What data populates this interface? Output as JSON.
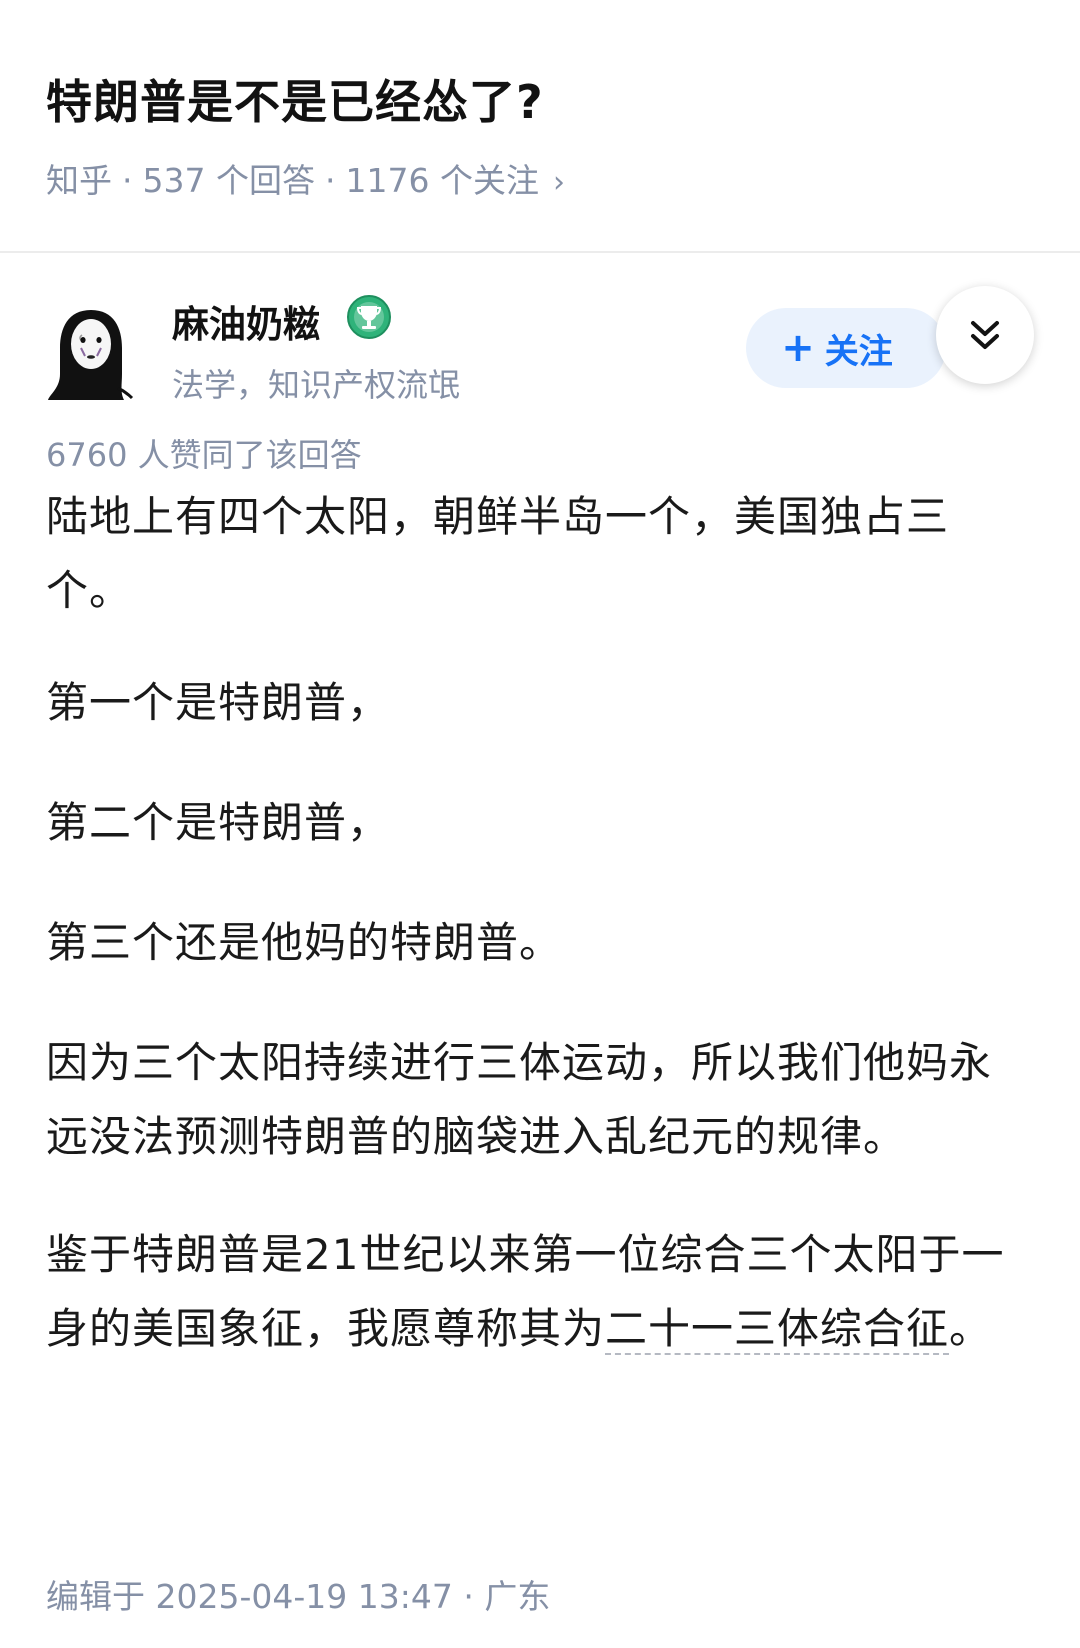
{
  "question": {
    "title": "特朗普是不是已经怂了?",
    "source": "知乎",
    "answers_count": "537 个回答",
    "followers_count": "1176 个关注",
    "separator": "·",
    "chevron": "›"
  },
  "author": {
    "name": "麻油奶糍",
    "bio": "法学，知识产权流氓",
    "badge_icon": "trophy-badge-icon",
    "follow_plus": "+",
    "follow_label": "关注",
    "collapse_icon": "double-chevron-down-icon"
  },
  "answer": {
    "votes": "6760 人赞同了该回答",
    "paragraphs": [
      "陆地上有四个太阳，朝鲜半岛一个，美国独占三个。",
      "第一个是特朗普，",
      "第二个是特朗普，",
      "第三个还是他妈的特朗普。",
      "因为三个太阳持续进行三体运动，所以我们他妈永远没法预测特朗普的脑袋进入乱纪元的规律。"
    ],
    "last_paragraph_before": "鉴于特朗普是21世纪以来第一位综合三个太阳于一身的美国象征，我愿尊称其为",
    "last_paragraph_term": "二十一三体综合征",
    "last_paragraph_after": "。",
    "edited": "编辑于 2025-04-19 13:47 · 广东"
  },
  "colors": {
    "accent": "#1772f6",
    "follow_bg": "#eaf2fd",
    "meta_text": "#8590a6",
    "badge_green": "#2fb37a"
  }
}
